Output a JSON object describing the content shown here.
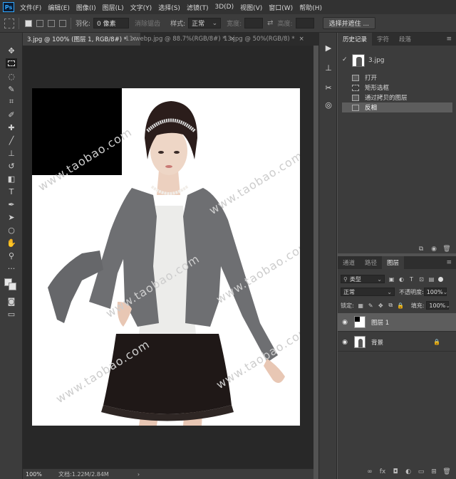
{
  "menu": {
    "logo": "Ps",
    "items": [
      "文件(F)",
      "编辑(E)",
      "图像(I)",
      "图层(L)",
      "文字(Y)",
      "选择(S)",
      "滤镜(T)",
      "3D(D)",
      "视图(V)",
      "窗口(W)",
      "帮助(H)"
    ]
  },
  "options": {
    "feather_label": "羽化:",
    "feather_value": "0 像素",
    "antialias_label": "消除锯齿",
    "style_label": "样式:",
    "style_value": "正常",
    "width_label": "宽度:",
    "height_label": "高度:",
    "swap_icon": "swap-icon",
    "select_mask_button": "选择并遮住 ..."
  },
  "doc_tabs": [
    {
      "label": "3.jpg @ 100% (图层 1, RGB/8#) *",
      "close": "×"
    },
    {
      "label": "11.webp.jpg @ 88.7%(RGB/8#) *",
      "close": "×"
    },
    {
      "label": "13.jpg @ 50%(RGB/8) *",
      "close": "×"
    }
  ],
  "canvas": {
    "watermark": "www.taobao.com",
    "background_color": "#282828"
  },
  "status": {
    "zoom": "100%",
    "doc_size": "文档:1.22M/2.84M",
    "arrow": "›"
  },
  "history_panel": {
    "tabs": [
      "历史记录",
      "字符",
      "段落"
    ],
    "menu_icon": "≡",
    "snapshot_label": "3.jpg",
    "items": [
      "打开",
      "矩形选框",
      "通过拷贝的图层",
      "反相"
    ],
    "active_index": 3
  },
  "layers_panel": {
    "tabs": [
      "通道",
      "路径",
      "图层"
    ],
    "menu_icon": "≡",
    "filter_label": "类型",
    "blend_mode": "正常",
    "opacity_label": "不透明度:",
    "opacity_value": "100%",
    "lock_label": "锁定:",
    "fill_label": "填充:",
    "fill_value": "100%",
    "layers": [
      {
        "name": "图层 1",
        "visible": true,
        "locked": false,
        "active": true
      },
      {
        "name": "背景",
        "visible": true,
        "locked": true,
        "active": false
      }
    ]
  },
  "colors": {
    "accent": "#31a8ff",
    "panel_bg": "#3c3c3c",
    "menubar_bg": "#323232",
    "active_row": "#5d5d5d"
  }
}
